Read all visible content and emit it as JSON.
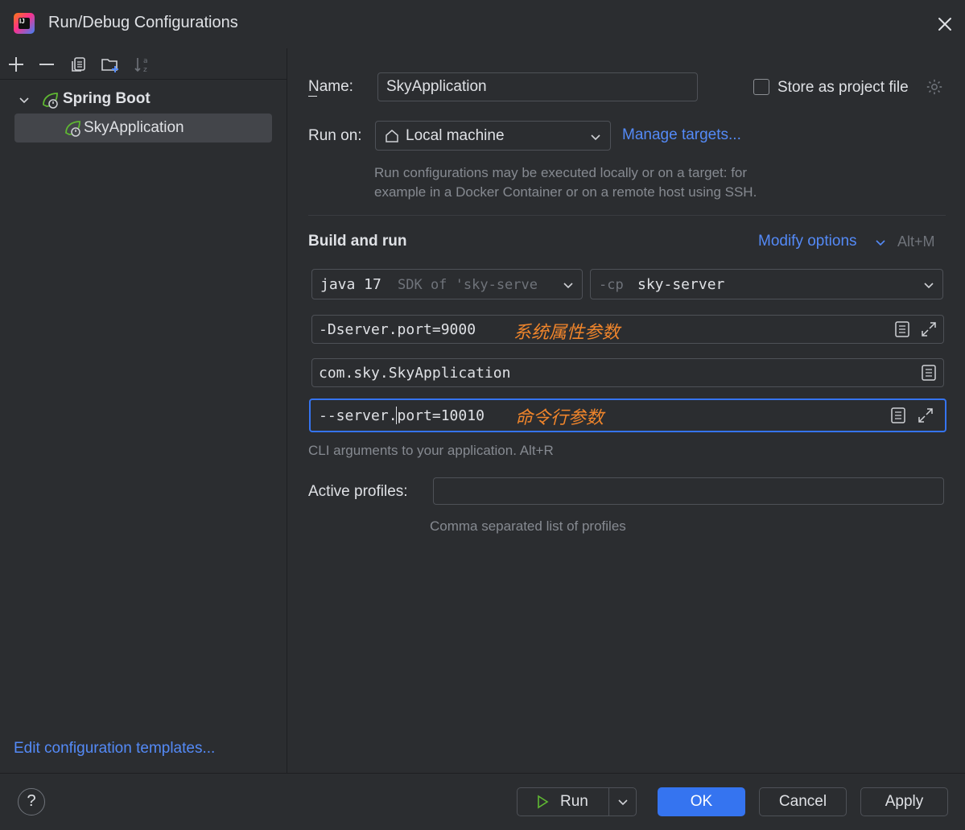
{
  "window": {
    "title": "Run/Debug Configurations"
  },
  "toolbar": {
    "icons": [
      "add-icon",
      "remove-icon",
      "copy-icon",
      "new-folder-icon",
      "sort-icon"
    ]
  },
  "tree": {
    "group_label": "Spring Boot",
    "item_label": "SkyApplication"
  },
  "left_footer": {
    "templates_link": "Edit configuration templates..."
  },
  "form": {
    "name_label": "Name:",
    "name_value": "SkyApplication",
    "store_label": "Store as project file",
    "run_on_label": "Run on:",
    "run_on_value": "Local machine",
    "manage_targets": "Manage targets...",
    "run_on_hint_1": "Run configurations may be executed locally or on a target: for",
    "run_on_hint_2": "example in a Docker Container or on a remote host using SSH.",
    "section_title": "Build and run",
    "modify_options": "Modify options",
    "modify_shortcut": "Alt+M",
    "jdk_value": "java 17",
    "jdk_hint": "SDK of 'sky-serve",
    "cp_prefix": "-cp",
    "cp_value": "sky-server",
    "vm_options": "-Dserver.port=9000",
    "vm_annotation": "系统属性参数",
    "main_class": "com.sky.SkyApplication",
    "program_args": "--server.port=10010",
    "args_annotation": "命令行参数",
    "args_hint": "CLI arguments to your application. Alt+R",
    "profiles_label": "Active profiles:",
    "profiles_value": "",
    "profiles_hint": "Comma separated list of profiles"
  },
  "buttons": {
    "help": "?",
    "run": "Run",
    "ok": "OK",
    "cancel": "Cancel",
    "apply": "Apply"
  },
  "colors": {
    "accent": "#3574f0",
    "link": "#548af7",
    "annotation": "#f0852b",
    "background": "#2b2d30"
  }
}
